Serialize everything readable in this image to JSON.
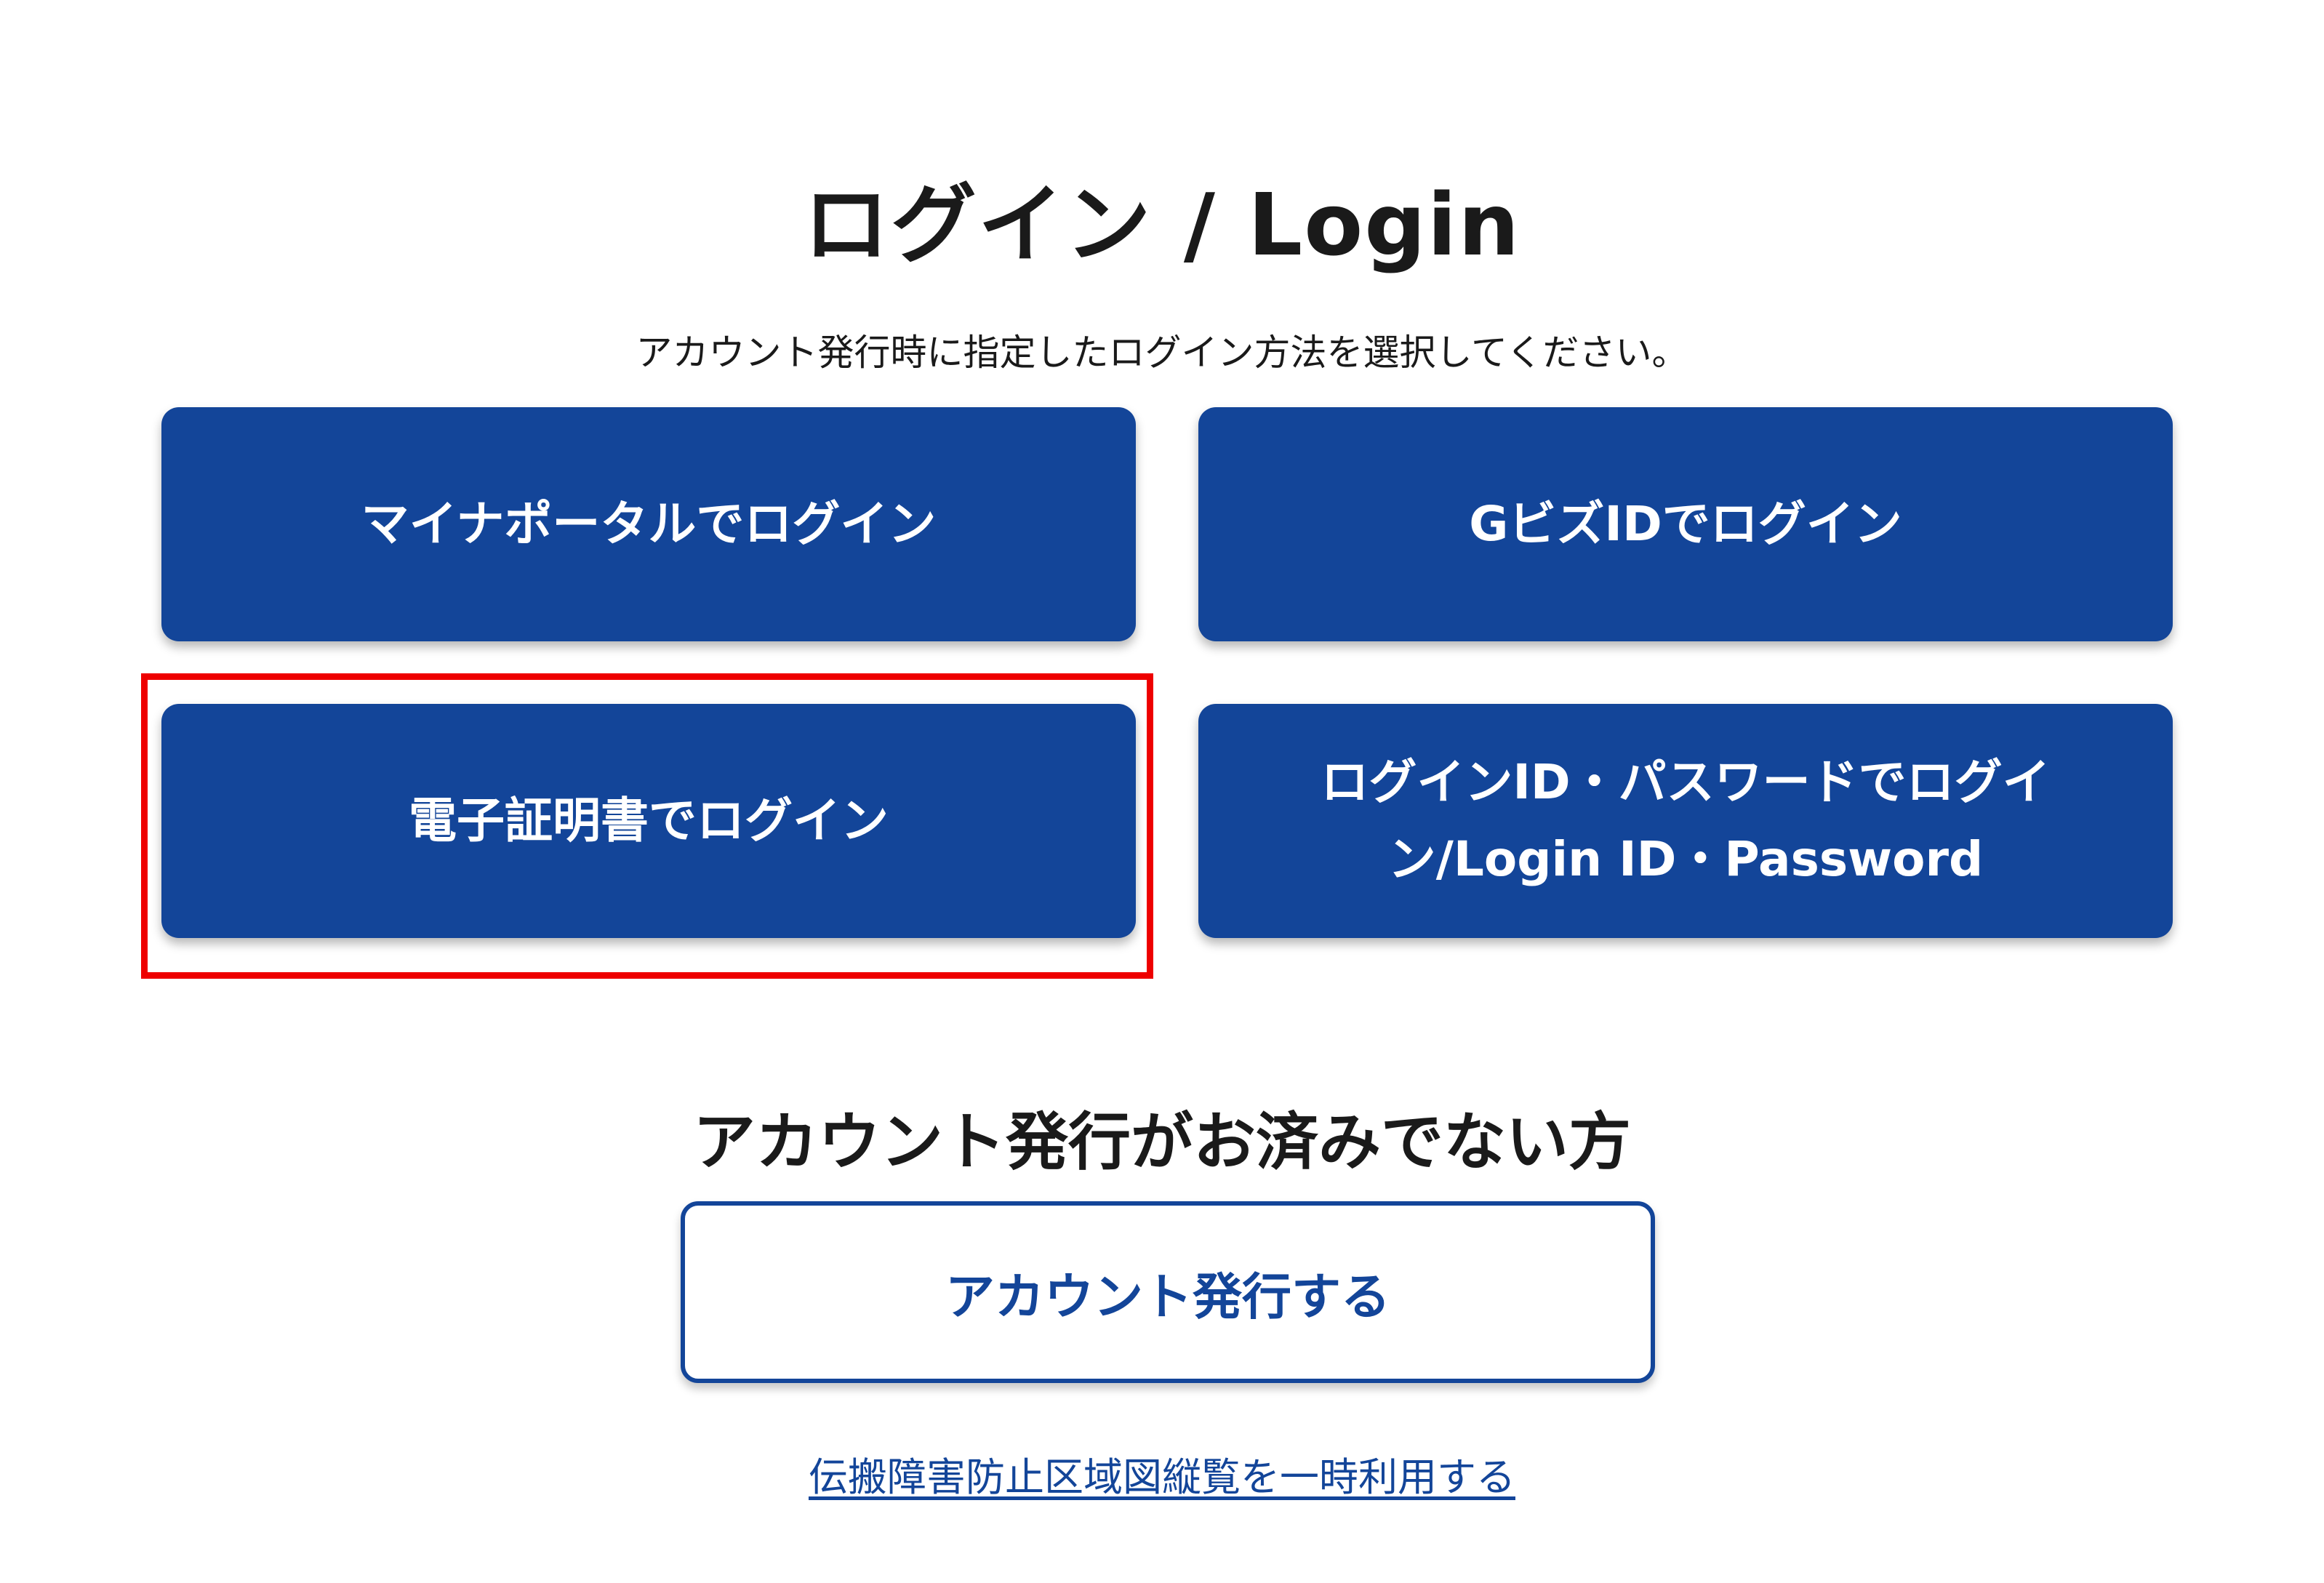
{
  "header": {
    "title": "ログイン / Login",
    "subtitle": "アカウント発行時に指定したログイン方法を選択してください。"
  },
  "login_options": {
    "myna_portal": "マイナポータルでログイン",
    "gbiz_id": "GビズIDでログイン",
    "certificate": "電子証明書でログイン",
    "login_id_password": "ログインID・パスワードでログイン/Login ID・Password"
  },
  "register_section": {
    "heading": "アカウント発行がお済みでない方",
    "button_label": "アカウント発行する"
  },
  "footer": {
    "temporary_use_link": "伝搬障害防止区域図縦覧を一時利用する"
  },
  "colors": {
    "primary": "#134599",
    "highlight": "#ee0000",
    "text": "#1a1a1a",
    "background": "#ffffff"
  }
}
